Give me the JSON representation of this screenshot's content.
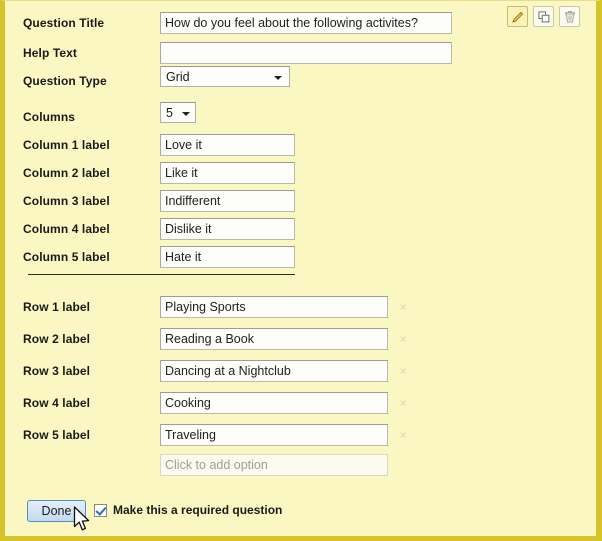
{
  "editor": {
    "question_title": {
      "label": "Question Title",
      "value": "How do you feel about the following activites?"
    },
    "help_text": {
      "label": "Help Text",
      "value": "",
      "placeholder": ""
    },
    "question_type": {
      "label": "Question Type",
      "selected": "Grid"
    },
    "columns_count": {
      "label": "Columns",
      "selected": "5"
    },
    "column_fields": [
      {
        "label": "Column 1 label",
        "value": "Love it"
      },
      {
        "label": "Column 2 label",
        "value": "Like it"
      },
      {
        "label": "Column 3 label",
        "value": "Indifferent"
      },
      {
        "label": "Column 4 label",
        "value": "Dislike it"
      },
      {
        "label": "Column 5 label",
        "value": "Hate it"
      }
    ],
    "row_fields": [
      {
        "label": "Row 1 label",
        "value": "Playing Sports",
        "remove": "×"
      },
      {
        "label": "Row 2 label",
        "value": "Reading a Book",
        "remove": "×"
      },
      {
        "label": "Row 3 label",
        "value": "Dancing at a Nightclub",
        "remove": "×"
      },
      {
        "label": "Row 4 label",
        "value": "Cooking",
        "remove": "×"
      },
      {
        "label": "Row 5 label",
        "value": "Traveling",
        "remove": "×"
      }
    ],
    "add_option": {
      "placeholder": "Click to add option"
    },
    "toolbar": {
      "edit_icon": "pencil-icon",
      "duplicate_icon": "copy-icon",
      "delete_icon": "trash-icon"
    },
    "footer": {
      "done_label": "Done",
      "required_label": "Make this a required question",
      "required_checked": true
    },
    "watermark": "",
    "colors": {
      "panel_background": "#fbf7c3",
      "panel_border": "#d6c229",
      "input_background": "#fdfdfa",
      "input_border": "#b8b8ae",
      "done_border": "#5b8bbd",
      "checkbox_check": "#2f6fb5",
      "divider": "#2b2b2b",
      "remove_x": "#d9d6b6",
      "placeholder_text": "#9e9e95"
    }
  }
}
